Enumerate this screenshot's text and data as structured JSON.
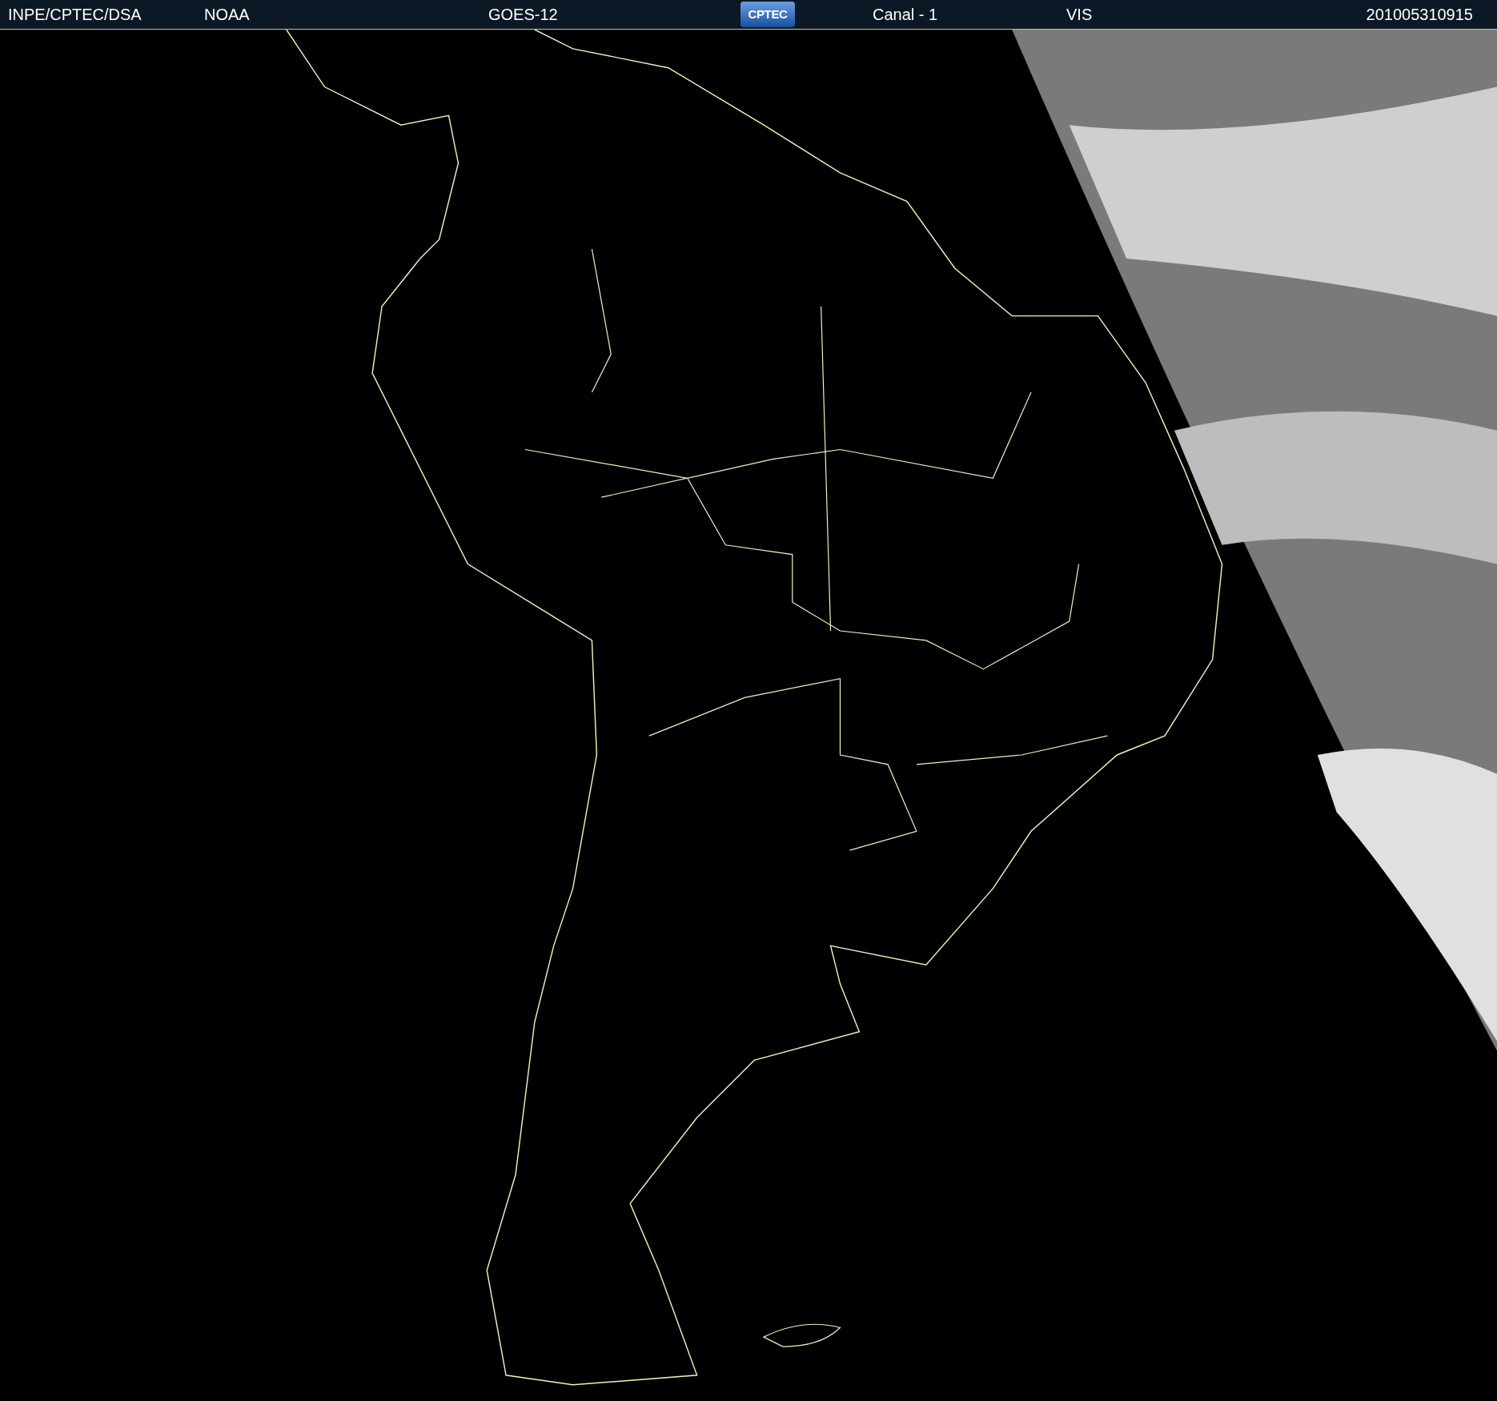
{
  "header": {
    "items": [
      {
        "kind": "text",
        "text": "INPE/CPTEC/DSA"
      },
      {
        "kind": "text",
        "text": "NOAA"
      },
      {
        "kind": "text",
        "text": "GOES-12"
      },
      {
        "kind": "logo",
        "text": "CPTEC"
      },
      {
        "kind": "text",
        "text": "Canal - 1"
      },
      {
        "kind": "text",
        "text": "VIS"
      },
      {
        "kind": "text",
        "text": "201005310915"
      }
    ]
  }
}
